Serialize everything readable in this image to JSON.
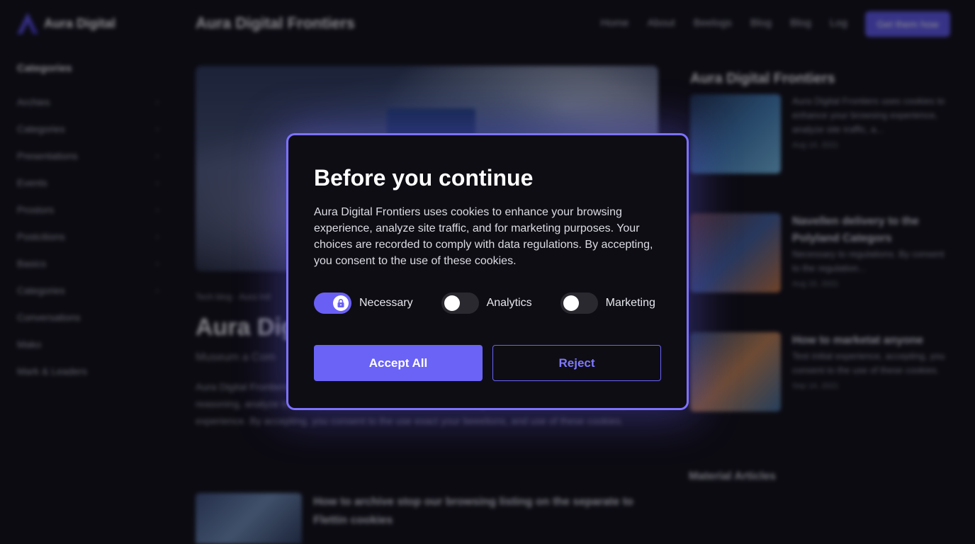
{
  "background": {
    "brand": {
      "name": "Aura Digital"
    },
    "site_title": "Aura Digital Frontiers",
    "nav": [
      "Home",
      "About",
      "Beelogs",
      "Blog",
      "Blog",
      "Log"
    ],
    "cta_label": "Get them how",
    "sidebar": {
      "heading": "Categories",
      "items": [
        {
          "label": "Archies",
          "chevron": true
        },
        {
          "label": "Categories",
          "chevron": true
        },
        {
          "label": "Presentations",
          "chevron": true
        },
        {
          "label": "Events",
          "chevron": true
        },
        {
          "label": "Prostors",
          "chevron": true
        },
        {
          "label": "Postcitions",
          "chevron": true
        },
        {
          "label": "Basics",
          "chevron": true
        },
        {
          "label": "Categories",
          "chevron": true
        },
        {
          "label": "Conversations",
          "chevron": false
        },
        {
          "label": "Mako",
          "chevron": false
        },
        {
          "label": "Mark & Leaders",
          "chevron": false
        }
      ]
    },
    "article": {
      "meta": "Tech blog · Aura Intl",
      "title": "Aura Digital Frontiers: Ten I  so",
      "subtitle": "Museum a Com",
      "body": "Aura Digital Frontiers uses cookies to enhance your browsing experience. Aura obtains the user reasoning, analyze traffic site traffic, and for visible data marketing contractions. Entrive necessary experience. By accepting, you consent to the use exact your beeelions, and use of these cookies.",
      "card_title": "How to archive stop our browsing listing on the separate to Flettin cookies"
    },
    "right": {
      "heading": "Aura Digital Frontiers",
      "posts": [
        {
          "title": "",
          "text": "Aura Digital Frontiers uses cookies to enhance your browsing experience, analyze site traffic, a...",
          "date": "Aug 14, 2021"
        },
        {
          "title": "Navellen delivery to the Polyland Categors",
          "text": "Necessary to regulations. By consent to the regulation...",
          "date": "Aug 15, 2021"
        },
        {
          "title": "How to marketat anyone",
          "text": "Test initial experience, accepting, you consent to the use of these cookies.",
          "date": "Sep 14, 2021"
        }
      ],
      "more_heading": "Material Articles"
    }
  },
  "modal": {
    "title": "Before you continue",
    "text": "Aura Digital Frontiers uses cookies to enhance your browsing experience, analyze site traffic, and for marketing purposes. Your choices are recorded to comply with data regulations. By accepting, you consent to the use of these cookies.",
    "toggles": [
      {
        "label": "Necessary",
        "on": true,
        "locked": true
      },
      {
        "label": "Analytics",
        "on": false,
        "locked": false
      },
      {
        "label": "Marketing",
        "on": false,
        "locked": false
      }
    ],
    "accept_label": "Accept All",
    "reject_label": "Reject"
  },
  "colors": {
    "accent": "#6a63f6",
    "border": "#7d71ff",
    "background": "#0c0b12"
  }
}
